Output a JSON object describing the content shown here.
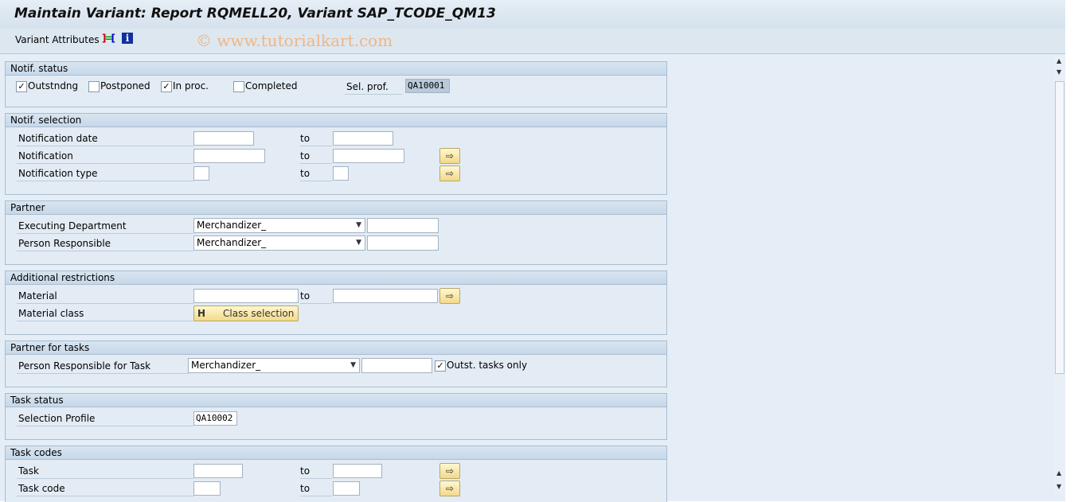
{
  "title": "Maintain Variant: Report RQMELL20, Variant SAP_TCODE_QM13",
  "toolbar": {
    "variant_attributes": "Variant Attributes",
    "icons": [
      "layout-icon",
      "info-icon"
    ],
    "watermark": "© www.tutorialkart.com"
  },
  "notif_status": {
    "header": "Notif. status",
    "outstanding": "Outstndng",
    "outstanding_checked": true,
    "postponed": "Postponed",
    "postponed_checked": false,
    "in_proc": "In proc.",
    "in_proc_checked": true,
    "completed": "Completed",
    "completed_checked": false,
    "sel_prof_label": "Sel. prof.",
    "sel_prof_value": "QA10001"
  },
  "notif_selection": {
    "header": "Notif. selection",
    "rows": [
      {
        "label": "Notification date",
        "to": "to"
      },
      {
        "label": "Notification",
        "to": "to"
      },
      {
        "label": "Notification type",
        "to": "to"
      }
    ]
  },
  "partner": {
    "header": "Partner",
    "rows": [
      {
        "label": "Executing Department",
        "value": "Merchandizer_"
      },
      {
        "label": "Person Responsible",
        "value": "Merchandizer_"
      }
    ]
  },
  "additional": {
    "header": "Additional restrictions",
    "material": "Material",
    "to": "to",
    "material_class": "Material class",
    "class_selection": "Class selection"
  },
  "partner_tasks": {
    "header": "Partner for tasks",
    "label": "Person Responsible for Task",
    "value": "Merchandizer_",
    "outst_tasks_only": "Outst. tasks only",
    "outst_checked": true
  },
  "task_status": {
    "header": "Task status",
    "label": "Selection Profile",
    "value": "QA10002"
  },
  "task_codes": {
    "header": "Task codes",
    "rows": [
      {
        "label": "Task",
        "to": "to"
      },
      {
        "label": "Task code",
        "to": "to"
      }
    ]
  }
}
